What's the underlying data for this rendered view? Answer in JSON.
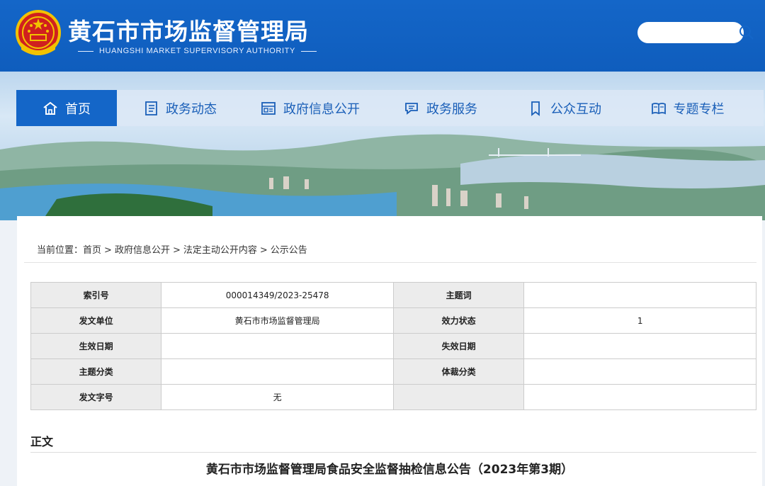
{
  "header": {
    "title": "黄石市市场监督管理局",
    "subtitle": "HUANGSHI MARKET SUPERVISORY AUTHORITY",
    "emblem_icon": "national-emblem-icon",
    "search": {
      "value": "",
      "placeholder": ""
    }
  },
  "nav": {
    "items": [
      {
        "label": "首页",
        "icon": "home-icon",
        "active": true
      },
      {
        "label": "政务动态",
        "icon": "news-icon"
      },
      {
        "label": "政府信息公开",
        "icon": "info-icon"
      },
      {
        "label": "政务服务",
        "icon": "service-icon"
      },
      {
        "label": "公众互动",
        "icon": "bookmark-icon"
      },
      {
        "label": "专题专栏",
        "icon": "book-icon"
      }
    ]
  },
  "breadcrumb": {
    "prefix": "当前位置：",
    "items": [
      "首页",
      "政府信息公开",
      "法定主动公开内容",
      "公示公告"
    ],
    "separator": ">"
  },
  "meta": {
    "rows": [
      {
        "k1": "索引号",
        "v1": "000014349/2023-25478",
        "k2": "主题词",
        "v2": ""
      },
      {
        "k1": "发文单位",
        "v1": "黄石市市场监督管理局",
        "k2": "效力状态",
        "v2": "1"
      },
      {
        "k1": "生效日期",
        "v1": "",
        "k2": "失效日期",
        "v2": ""
      },
      {
        "k1": "主题分类",
        "v1": "",
        "k2": "体裁分类",
        "v2": ""
      },
      {
        "k1": "发文字号",
        "v1": "无",
        "k2": "",
        "v2": ""
      }
    ]
  },
  "content": {
    "label": "正文",
    "title": "黄石市市场监督管理局食品安全监督抽检信息公告（2023年第3期）"
  },
  "colors": {
    "brand": "#1466c8",
    "nav_text": "#1a5fb8",
    "table_key_bg": "#ececec"
  }
}
